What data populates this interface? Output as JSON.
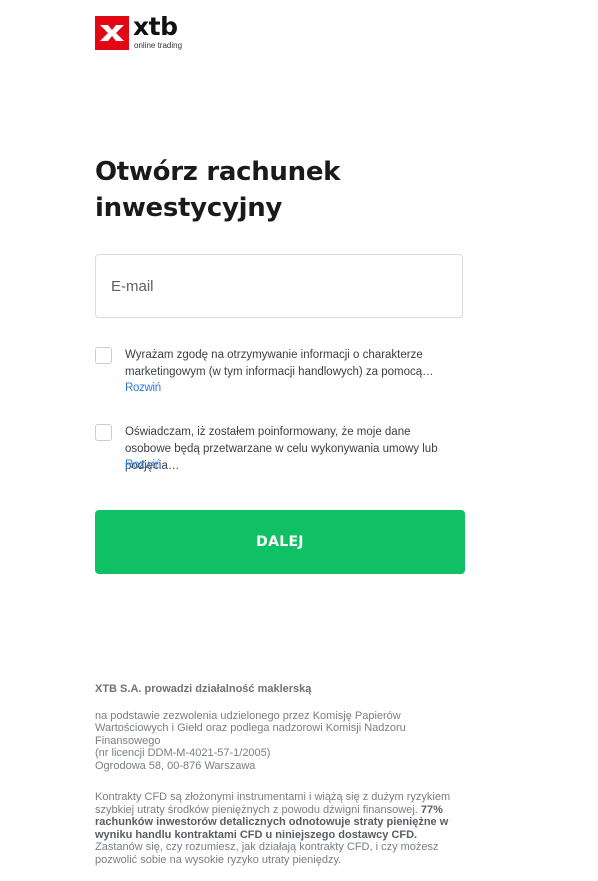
{
  "brand": {
    "name": "xtb",
    "tagline": "online trading",
    "accent": "#e30613"
  },
  "title": "Otwórz rachunek inwestycyjny",
  "email": {
    "placeholder": "E-mail",
    "value": ""
  },
  "consents": [
    {
      "checked": false,
      "text": "Wyrażam zgodę na otrzymywanie informacji o charakterze marketingowym (w tym informacji handlowych) za pomocą…",
      "expand_label": "Rozwiń"
    },
    {
      "checked": false,
      "text": "Oświadczam, iż zostałem poinformowany, że moje dane osobowe będą przetwarzane w celu wykonywania umowy lub podjęcia…",
      "expand_label": "Rozwiń"
    }
  ],
  "next_button": {
    "label": "DALEJ",
    "color": "#0fc164"
  },
  "footer": {
    "heading": "XTB S.A. prowadzi działalność maklerską",
    "license_line_1": "na podstawie zezwolenia udzielonego przez Komisję Papierów Wartościowych i Giełd oraz podlega nadzorowi Komisji Nadzoru Finansowego",
    "license_line_2": "(nr licencji DDM-M-4021-57-1/2005)",
    "license_line_3": "Ogrodowa 58, 00-876 Warszawa",
    "risk_part_1": "Kontrakty CFD są złożonymi instrumentami i wiążą się z dużym ryzykiem szybkiej utraty środków pieniężnych z powodu dźwigni finansowej. ",
    "risk_bold": "77% rachunków inwestorów detalicznych odnotowuje straty pieniężne w wyniku handlu kontraktami CFD u niniejszego dostawcy CFD.",
    "risk_part_2": " Zastanów się, czy rozumiesz, jak działają kontrakty CFD, i czy możesz pozwolić sobie na wysokie ryzyko utraty pieniędzy."
  }
}
